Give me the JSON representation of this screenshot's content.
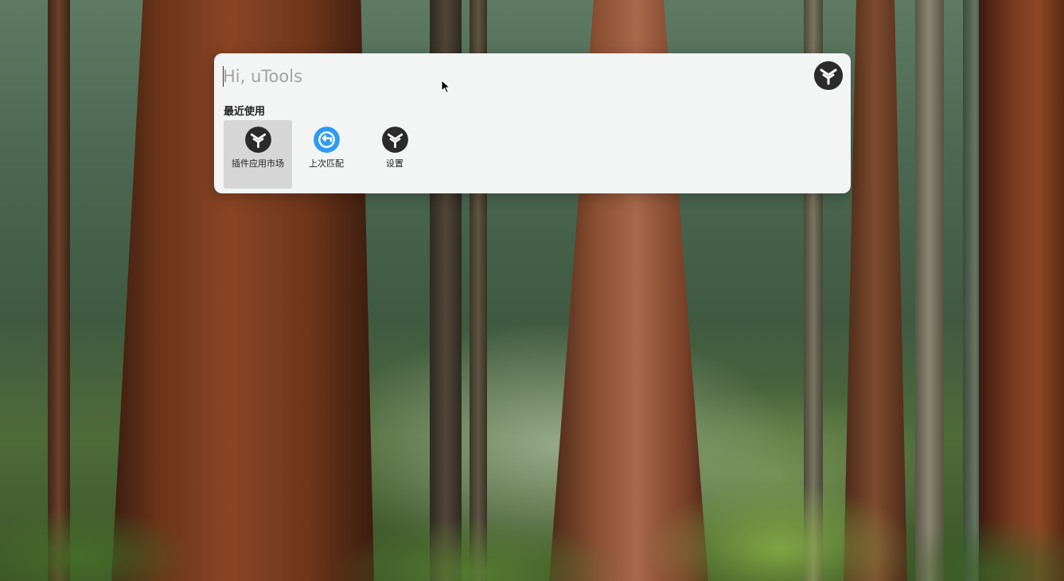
{
  "search": {
    "placeholder": "Hi, uTools"
  },
  "header": {
    "logo_icon": "utools-logo-icon"
  },
  "recent": {
    "title": "最近使用",
    "items": [
      {
        "label": "插件应用市场",
        "icon": "utools-logo-icon",
        "selected": true
      },
      {
        "label": "上次匹配",
        "icon": "undo-icon"
      },
      {
        "label": "设置",
        "icon": "utools-logo-icon"
      }
    ]
  },
  "colors": {
    "panel_bg": "#f3f4f4",
    "logo_bg": "#2b2b2b",
    "accent_blue": "#2f9bf0",
    "selected_bg": "#d6d6d6"
  }
}
